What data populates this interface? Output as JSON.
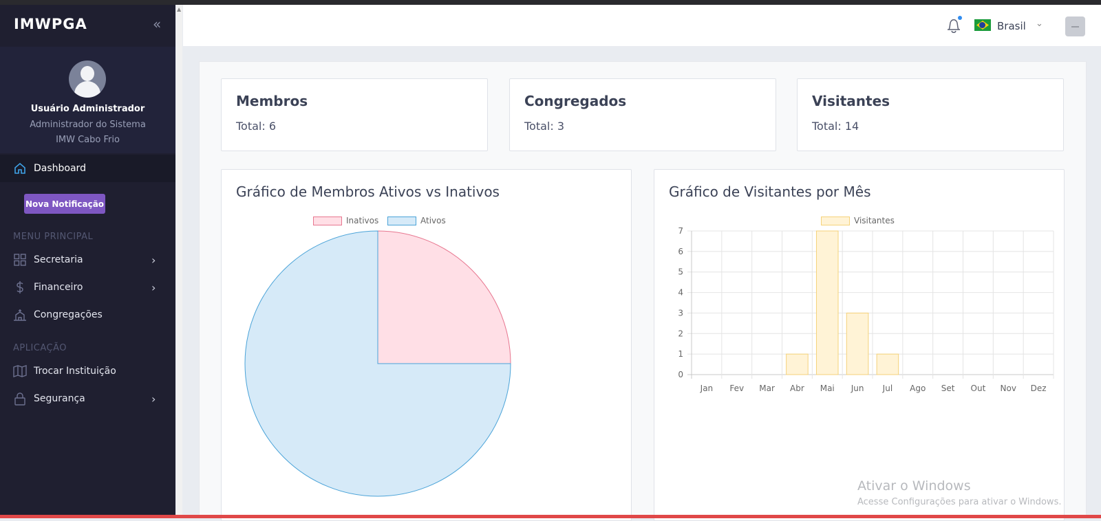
{
  "app": {
    "brand": "IMWPGA"
  },
  "profile": {
    "name": "Usuário Administrador",
    "role": "Administrador do Sistema",
    "church": "IMW Cabo Frio"
  },
  "sidebar": {
    "dashboard": "Dashboard",
    "notify_button": "Nova Notificação",
    "section_main": "MENU PRINCIPAL",
    "items_main": [
      {
        "label": "Secretaria",
        "icon": "grid-icon"
      },
      {
        "label": "Financeiro",
        "icon": "dollar-icon"
      },
      {
        "label": "Congregações",
        "icon": "church-icon"
      }
    ],
    "section_app": "APLICAÇÃO",
    "items_app": [
      {
        "label": "Trocar Instituição",
        "icon": "map-icon"
      },
      {
        "label": "Segurança",
        "icon": "lock-icon"
      }
    ]
  },
  "header": {
    "country": "Brasil"
  },
  "cards": [
    {
      "title": "Membros",
      "total": "Total: 6"
    },
    {
      "title": "Congregados",
      "total": "Total: 3"
    },
    {
      "title": "Visitantes",
      "total": "Total: 14"
    }
  ],
  "colors": {
    "accent": "#7e57c2",
    "pie_inativos_fill": "#ffdfe6",
    "pie_inativos_border": "#e7768f",
    "pie_ativos_fill": "#d6eaf8",
    "pie_ativos_border": "#4aa3d8",
    "bar_fill": "#fff3d6",
    "bar_border": "#f5d27a"
  },
  "chart_data": [
    {
      "type": "pie",
      "title": "Gráfico de Membros Ativos vs Inativos",
      "labels": [
        "Inativos",
        "Ativos"
      ],
      "values": [
        25,
        75
      ],
      "legend": "top"
    },
    {
      "type": "bar",
      "title": "Gráfico de Visitantes por Mês",
      "categories": [
        "Jan",
        "Fev",
        "Mar",
        "Abr",
        "Mai",
        "Jun",
        "Jul",
        "Ago",
        "Set",
        "Out",
        "Nov",
        "Dez"
      ],
      "series": [
        {
          "name": "Visitantes",
          "values": [
            0,
            0,
            0,
            1,
            7,
            3,
            1,
            0,
            0,
            0,
            0,
            0
          ]
        }
      ],
      "yticks": [
        "0",
        "1",
        "2",
        "3",
        "4",
        "5",
        "6",
        "7"
      ],
      "ylim": [
        0,
        7
      ],
      "grid": true,
      "legend": "top"
    }
  ],
  "watermark": {
    "line1": "Ativar o Windows",
    "line2": "Acesse Configurações para ativar o Windows."
  }
}
